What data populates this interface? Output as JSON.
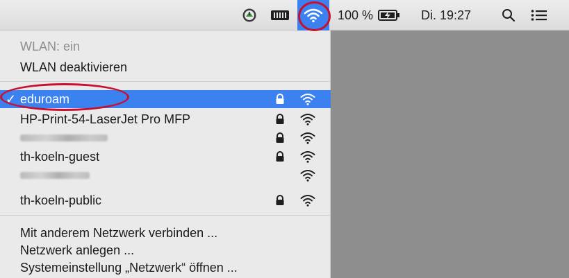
{
  "menubar": {
    "battery_percent": "100 %",
    "datetime": "Di. 19:27",
    "icons": [
      "time-machine-icon",
      "keyboard-icon",
      "wifi-icon",
      "battery-charging-icon",
      "spotlight-search-icon",
      "notification-list-icon"
    ]
  },
  "wlan_menu": {
    "status": "WLAN: ein",
    "toggle_label": "WLAN deaktivieren",
    "networks": [
      {
        "name": "eduroam",
        "selected": true,
        "locked": true
      },
      {
        "name": "HP-Print-54-LaserJet Pro MFP",
        "selected": false,
        "locked": true
      },
      {
        "name": "",
        "selected": false,
        "locked": true,
        "obscured": true
      },
      {
        "name": "th-koeln-guest",
        "selected": false,
        "locked": true
      },
      {
        "name": "",
        "selected": false,
        "locked": false,
        "obscured": true
      },
      {
        "name": "th-koeln-public",
        "selected": false,
        "locked": true
      }
    ],
    "actions": [
      {
        "label": "Mit anderem Netzwerk verbinden ..."
      },
      {
        "label": "Netzwerk anlegen ..."
      },
      {
        "label": "Systemeinstellung „Netzwerk“ öffnen ..."
      }
    ],
    "checkmark": "✓"
  },
  "colors": {
    "selection": "#3b82f0",
    "annotation": "#c8102e",
    "desktop": "#8e8e8e"
  }
}
